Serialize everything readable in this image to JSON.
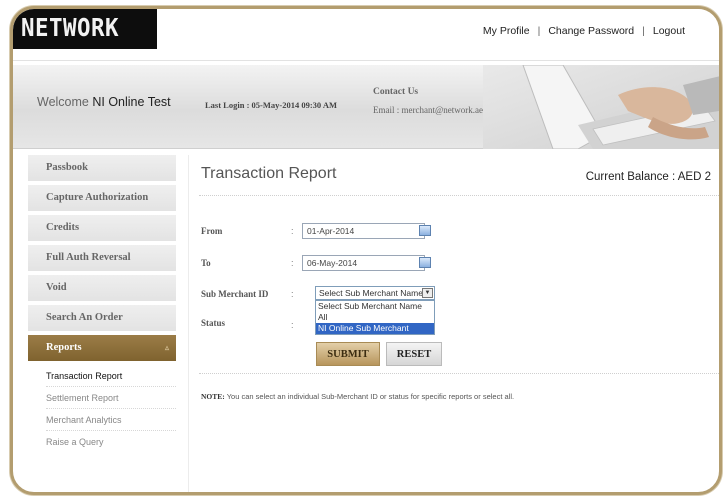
{
  "header": {
    "logo_text": "NETWORK",
    "nav": [
      "My Profile",
      "Change Password",
      "Logout"
    ]
  },
  "band": {
    "welcome_prefix": "Welcome",
    "user_name": "NI Online Test",
    "last_login": "Last Login : 05-May-2014 09:30 AM",
    "contact_title": "Contact Us",
    "contact_email": "Email : merchant@network.ae"
  },
  "sidebar": {
    "items": [
      "Passbook",
      "Capture Authorization",
      "Credits",
      "Full Auth Reversal",
      "Void",
      "Search An Order"
    ],
    "active": "Reports",
    "sub_items": [
      "Transaction Report",
      "Settlement Report",
      "Merchant Analytics",
      "Raise a Query"
    ]
  },
  "main": {
    "title": "Transaction Report",
    "balance": "Current Balance : AED  2",
    "from_label": "From",
    "from_value": "01-Apr-2014",
    "to_label": "To",
    "to_value": "06-May-2014",
    "colon": ":",
    "sub_merchant_label": "Sub Merchant ID",
    "sub_merchant_selected": "Select Sub Merchant Name",
    "sub_merchant_options": [
      "Select Sub Merchant Name",
      "All",
      "NI Online Sub Merchant"
    ],
    "status_label": "Status",
    "submit_label": "SUBMIT",
    "reset_label": "RESET",
    "note_label": "NOTE:",
    "note_text": " You can select an individual Sub-Merchant ID or status for specific reports or select all."
  },
  "colors": {
    "accent_gold": "#9b7c47",
    "frame_border": "#b39d6f",
    "highlight_blue": "#3166c4"
  }
}
